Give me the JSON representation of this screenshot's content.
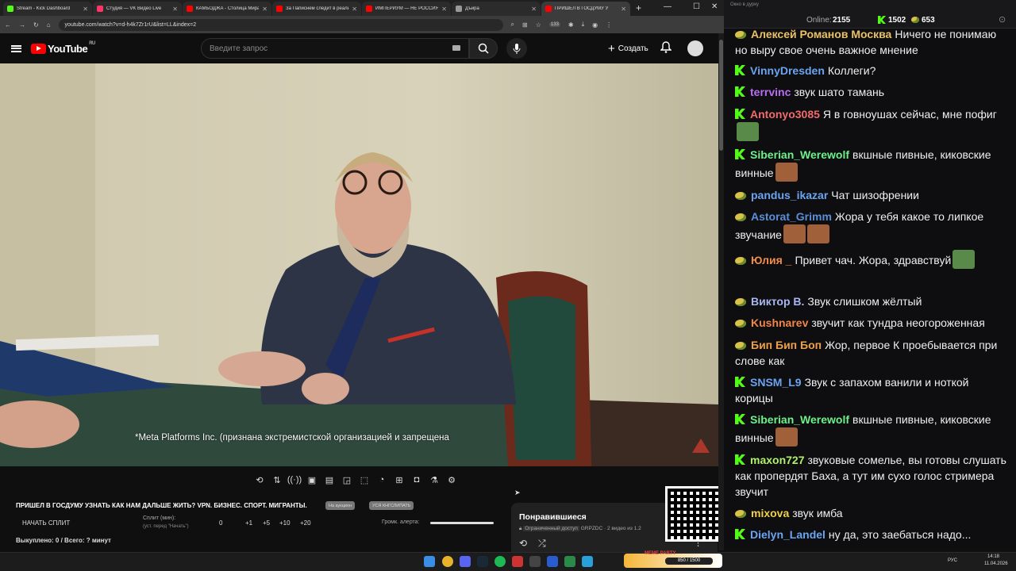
{
  "browser": {
    "tabs": [
      {
        "title": "Stream - Kick Dashboard",
        "color": "#53fc18"
      },
      {
        "title": "Студия — VK Видео Live",
        "color": "#ff3366"
      },
      {
        "title": "КАМБОДЖА - Столица Мира",
        "color": "#ff0000"
      },
      {
        "title": "За Паписнем следит в реальн",
        "color": "#ff0000"
      },
      {
        "title": "ИМПЕРИУМ — НЕ РОССИЯ",
        "color": "#ff0000"
      },
      {
        "title": "Дъйра",
        "color": "#999999"
      },
      {
        "title": "ПРИШЕЛ В ГОСДУМУ У",
        "color": "#ff0000"
      }
    ],
    "url": "youtube.com/watch?v=d-h4k7Zr1rU&list=LL&index=2",
    "ext_count": "133"
  },
  "youtube": {
    "logo_text": "YouTube",
    "region": "RU",
    "search_placeholder": "Введите запрос",
    "create_label": "Создать",
    "subtitle": "*Meta Platforms Inc. (признана экстремистской организацией и запрещена",
    "video_title": "ПРИШЕЛ В ГОСДУМУ УЗНАТЬ КАК НАМ ДАЛЬШЕ ЖИТЬ? VPN. БИЗНЕС. СПОРТ. МИГРАНТЫ.",
    "pill1": "На аукцион",
    "pill2": "УСЯ КНГСЛИПАТЬ",
    "split_button": "НАЧАТЬ СПЛИТ",
    "split_label": "Сплит (мин):",
    "split_hint": "(уст. перед \"Начать\")",
    "split_value": "0",
    "inc": [
      "+1",
      "+5",
      "+10",
      "+20"
    ],
    "alert_label": "Громк. алерта:",
    "bought": "Выкуплено: 0 / Всего: ? минут",
    "liked_title": "Понравившиеся",
    "liked_access": "Ограниченный доступ",
    "liked_meta": "GRPZDC · 2 видео из 1.2"
  },
  "chat": {
    "popout_title": "Окно в дурку",
    "online_label": "Online:",
    "online_value": "2155",
    "kick_count": "1502",
    "other_count": "653",
    "messages": [
      {
        "badge": "d",
        "user": "Алексей Романов Москва",
        "color": "#e8c168",
        "text": "Ничего не понимаю но выру свое очень важное мнение"
      },
      {
        "badge": "k",
        "user": "VinnyDresden",
        "color": "#6ba4f0",
        "text": "Коллеги?"
      },
      {
        "badge": "k",
        "user": "terrvinc",
        "color": "#b86df2",
        "text": "звук шато тамань"
      },
      {
        "badge": "k",
        "user": "Antonyo3085",
        "color": "#f06b6b",
        "text": "Я в говноушах сейчас, мне пофиг"
      },
      {
        "badge": "k",
        "user": "Siberian_Werewolf",
        "color": "#6ef08a",
        "text": "вкшные пивные, киковские винные"
      },
      {
        "badge": "d",
        "user": "pandus_ikazar",
        "color": "#6ba4f0",
        "text": "Чат шизофрении"
      },
      {
        "badge": "d",
        "user": "Astorat_Grimm",
        "color": "#5a8ed8",
        "text": "Жора у тебя какое то липкое звучание"
      },
      {
        "badge": "d",
        "user": "Юлия _",
        "color": "#f28c4a",
        "text": "Привет чач. Жора, здравствуй"
      },
      {
        "badge": "d",
        "user": "Виктор В.",
        "color": "#a7b7f2",
        "text": "Звук слишком жёлтый"
      },
      {
        "badge": "d",
        "user": "Kushnarev",
        "color": "#f0864a",
        "text": "звучит как тундра неогороженная"
      },
      {
        "badge": "d",
        "user": "Бип Бип Боп",
        "color": "#f0a04a",
        "text": "Жор, первое К проебывается при слове как"
      },
      {
        "badge": "k",
        "user": "SNSM_L9",
        "color": "#6ba4f0",
        "text": "Звук с запахом ванили и ноткой корицы"
      },
      {
        "badge": "k",
        "user": "Siberian_Werewolf",
        "color": "#6ef08a",
        "text": "вкшные пивные, киковские винные"
      },
      {
        "badge": "k",
        "user": "maxon727",
        "color": "#b0f06b",
        "text": "звуковые сомелье, вы готовы слушать как пропердят Баха, а тут им сухо голос стримера звучит"
      },
      {
        "badge": "d",
        "user": "mixova",
        "color": "#f0d04a",
        "text": "звук имба"
      },
      {
        "badge": "k",
        "user": "Dielyn_Landel",
        "color": "#6ba4f0",
        "text": "ну да, это заебаться надо..."
      }
    ]
  },
  "taskbar": {
    "widget": "850 / 1500",
    "widget_title": "MEME PARTY",
    "lang": "РУС",
    "time": "14:18",
    "date": "11.04.2026"
  },
  "icons": {
    "accent_kick": "#53fc18",
    "yt_red": "#ff0000"
  }
}
